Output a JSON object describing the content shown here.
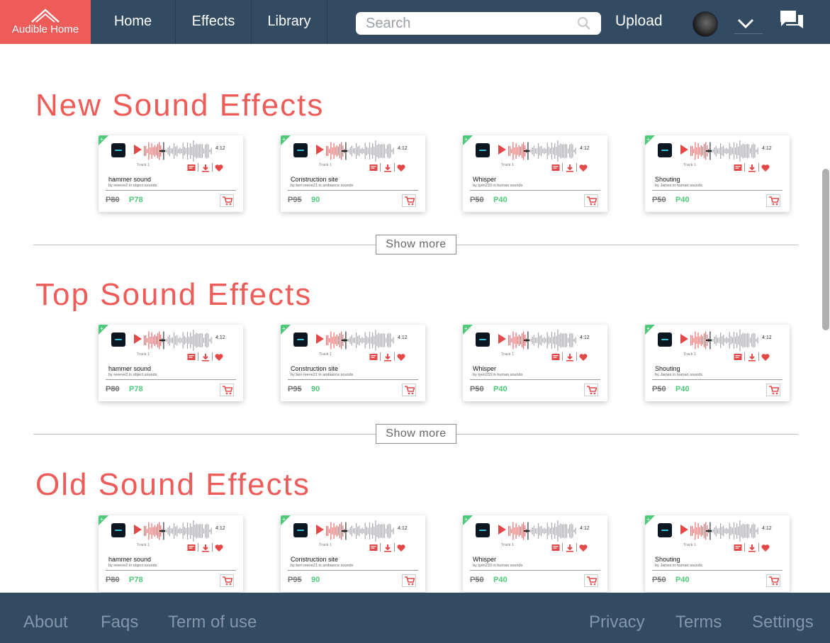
{
  "header": {
    "brand": "Audible Home",
    "nav": [
      "Home",
      "Effects",
      "Library"
    ],
    "search_placeholder": "Search",
    "upload": "Upload"
  },
  "sections": [
    {
      "title": "New Sound Effects",
      "show_more": "Show more"
    },
    {
      "title": "Top Sound Effects",
      "show_more": "Show more"
    },
    {
      "title": "Old Sound Effects",
      "show_more": ""
    }
  ],
  "cards": [
    {
      "name": "hammer sound",
      "by": "by reeeve2 in object sounds",
      "old_price": "P80",
      "price": "P78",
      "duration": "4:12",
      "track": "Track 1"
    },
    {
      "name": "Construction site",
      "by": "by ben reeve21 in ambiance sounds",
      "old_price": "P95",
      "price": "90",
      "duration": "4:12",
      "track": "Track 1"
    },
    {
      "name": "Whisper",
      "by": "by tyen233 in human sounds",
      "old_price": "P50",
      "price": "P40",
      "duration": "4:12",
      "track": "Track 1"
    },
    {
      "name": "Shouting",
      "by": "by James in human sounds",
      "old_price": "P50",
      "price": "P40",
      "duration": "4:12",
      "track": "Track 1"
    }
  ],
  "footer": {
    "left": [
      "About",
      "Faqs",
      "Term of use"
    ],
    "right": [
      "Privacy",
      "Terms",
      "Settings"
    ]
  },
  "colors": {
    "accent": "#ed5c59",
    "navy": "#334a63",
    "green": "#4ec97a"
  },
  "icons": [
    "home-icon",
    "search-icon",
    "chevron-down-icon",
    "chat-icon",
    "play-icon",
    "waveform",
    "playlist-add-icon",
    "download-icon",
    "heart-icon",
    "cart-icon"
  ]
}
